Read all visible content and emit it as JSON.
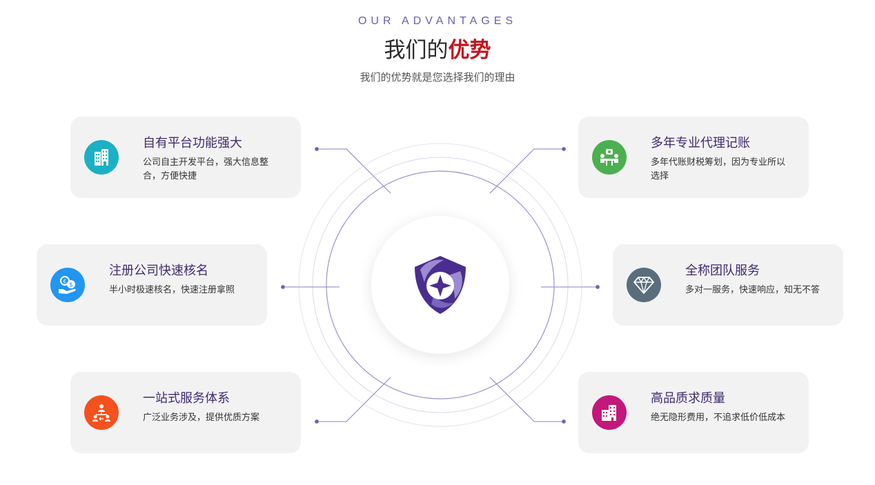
{
  "header": {
    "eyebrow": "OUR ADVANTAGES",
    "title_plain": "我们的",
    "title_accent": "优势",
    "subtitle": "我们的优势就是您选择我们的理由"
  },
  "colors": {
    "accent_red": "#c3141f",
    "purple": "#6b5bb0",
    "card_bg": "#f2f2f3"
  },
  "center": {
    "icon": "shield-star-logo-icon"
  },
  "advantages": [
    {
      "title": "自有平台功能强大",
      "desc": "公司自主开发平台，强大信息整合，方便快捷",
      "icon": "building-icon",
      "color": "#1bb0c3"
    },
    {
      "title": "多年专业代理记账",
      "desc": "多年代账财税筹划，因为专业所以选择",
      "icon": "meeting-icon",
      "color": "#4caf50"
    },
    {
      "title": "注册公司快速核名",
      "desc": "半小时极速核名，快速注册拿照",
      "icon": "money-hand-icon",
      "color": "#2196f3"
    },
    {
      "title": "全称团队服务",
      "desc": "多对一服务，快速响应，知无不答",
      "icon": "diamond-icon",
      "color": "#5a6d7c"
    },
    {
      "title": "一站式服务体系",
      "desc": "广泛业务涉及，提供优质方案",
      "icon": "team-transfer-icon",
      "color": "#f4511e"
    },
    {
      "title": "高品质求质量",
      "desc": "绝无隐形费用，不追求低价低成本",
      "icon": "office-building-icon",
      "color": "#c2187a"
    }
  ]
}
